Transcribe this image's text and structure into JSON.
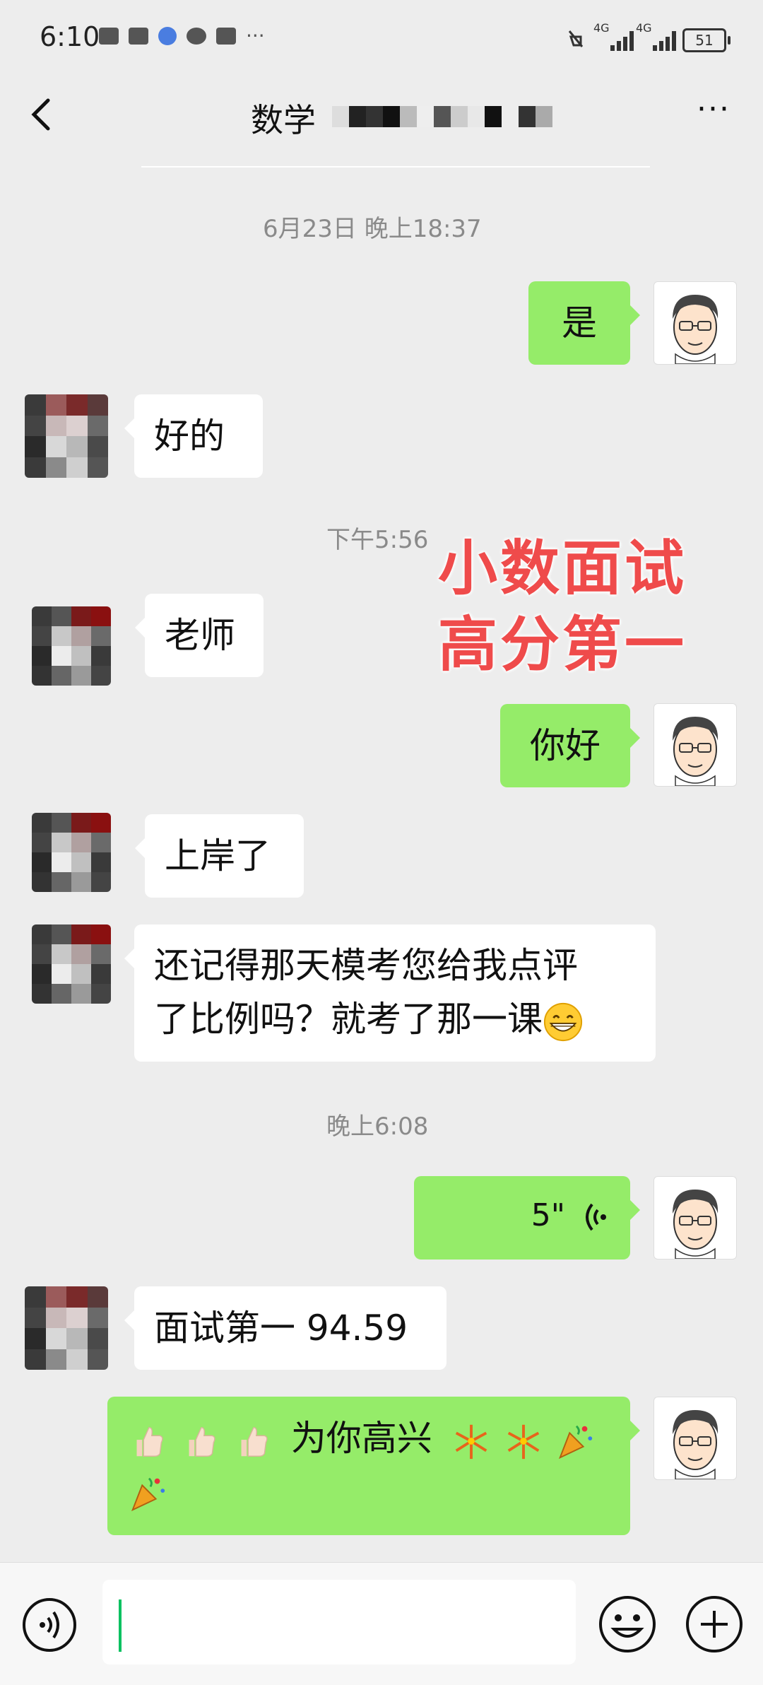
{
  "status_bar": {
    "time": "6:10",
    "battery": "51",
    "net1": "4G",
    "net2": "4G"
  },
  "header": {
    "title": "数学",
    "more": "···"
  },
  "messages": [
    {
      "type": "timestamp",
      "text": "6月23日 晚上18:37"
    },
    {
      "type": "out",
      "text": "是"
    },
    {
      "type": "in",
      "text": "好的"
    },
    {
      "type": "timestamp",
      "text": "下午5:56"
    },
    {
      "type": "in",
      "text": "老师"
    },
    {
      "type": "out",
      "text": "你好"
    },
    {
      "type": "in",
      "text": "上岸了"
    },
    {
      "type": "in",
      "line1": "还记得那天模考您给我点评",
      "line2": "了比例吗？就考了那一课",
      "emoji": "grinning-face-emoji"
    },
    {
      "type": "timestamp",
      "text": "晚上6:08"
    },
    {
      "type": "voice",
      "duration": "5\""
    },
    {
      "type": "in",
      "text": "面试第一 94.59"
    },
    {
      "type": "out",
      "text": "为你高兴",
      "emojis": [
        "thumbs-up",
        "thumbs-up",
        "thumbs-up",
        "fireworks",
        "fireworks",
        "party-popper",
        "party-popper"
      ]
    }
  ],
  "overlay": {
    "line1": "小数面试",
    "line2": "高分第一",
    "color": "#ef4b4b"
  },
  "colors": {
    "background": "#ededed",
    "outgoing_bubble": "#95ec69",
    "incoming_bubble": "#ffffff",
    "cursor": "#07c160"
  }
}
